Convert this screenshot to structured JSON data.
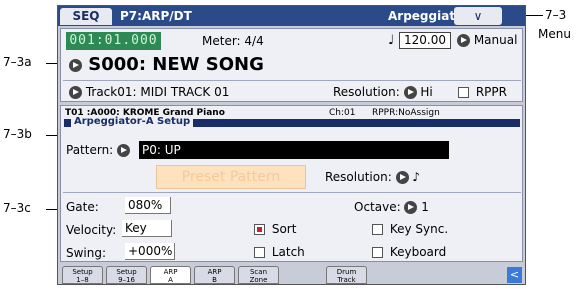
{
  "header": {
    "mode_tab": "SEQ",
    "page_title": "P7:ARP/DT",
    "mode_title": "Arpeggiator A",
    "menu_glyph": "∨"
  },
  "transport": {
    "location": "001:01.000",
    "meter": "Meter:  4/4",
    "tempo_symbol": "♩ =",
    "tempo": "120.00",
    "tempo_mode": "Manual"
  },
  "song": {
    "name": "S000: NEW SONG"
  },
  "track": {
    "label": "Track01: MIDI TRACK 01",
    "resolution_label": "Resolution:",
    "resolution_value": "Hi",
    "rppr_label": "RPPR",
    "rppr_checked": false
  },
  "track_info": {
    "name": "T01 :A000: KROME Grand Piano",
    "channel": "Ch:01",
    "rppr": "RPPR:NoAssign"
  },
  "arp_setup": {
    "title": "Arpeggiator-A Setup",
    "pattern_label": "Pattern:",
    "pattern_value": "P0: UP",
    "preset_button": "Preset Pattern",
    "resolution_label": "Resolution:",
    "resolution_value": "♪",
    "gate_label": "Gate:",
    "gate_value": "080%",
    "octave_label": "Octave:",
    "octave_value": "1",
    "velocity_label": "Velocity:",
    "velocity_value": "Key",
    "sort_label": "Sort",
    "sort_checked": true,
    "keysync_label": "Key Sync.",
    "keysync_checked": false,
    "swing_label": "Swing:",
    "swing_value": "+000%",
    "latch_label": "Latch",
    "latch_checked": false,
    "keyboard_label": "Keyboard",
    "keyboard_checked": false
  },
  "tabs": [
    {
      "line1": "Setup",
      "line2": "1–8",
      "active": false
    },
    {
      "line1": "Setup",
      "line2": "9–16",
      "active": false
    },
    {
      "line1": "ARP",
      "line2": "A",
      "active": true
    },
    {
      "line1": "ARP",
      "line2": "B",
      "active": false
    },
    {
      "line1": "Scan",
      "line2": "Zone",
      "active": false
    },
    {
      "line1": "Drum",
      "line2": "Track",
      "active": false
    }
  ],
  "back_glyph": "<",
  "callouts": {
    "c73": "7–3",
    "menu": "Menu",
    "c73a": "7–3a",
    "c73b": "7–3b",
    "c73c": "7–3c"
  }
}
